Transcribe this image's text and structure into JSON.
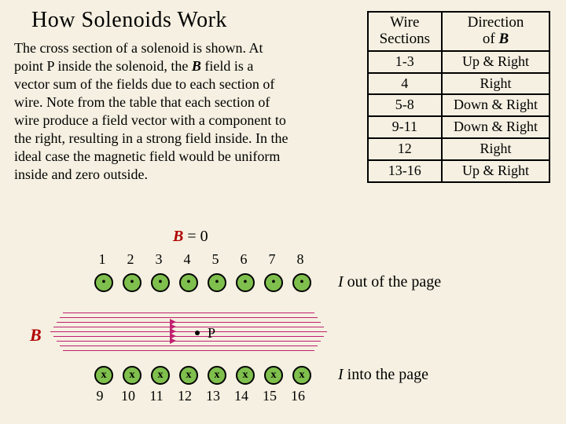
{
  "title": "How Solenoids Work",
  "body_before_B": "The cross section of a solenoid is shown. At point P inside the solenoid, the ",
  "body_B": "B",
  "body_after_B": " field is a vector sum of the fields due to each section of wire. Note from the table that each section of wire produce a field vector with a component to the right, resulting in a strong field inside.  In the ideal case the magnetic field would be uniform inside and zero outside.",
  "table": {
    "head1_a": "Wire",
    "head1_b": "Sections",
    "head2_a": "Direction",
    "head2_b": "of",
    "head2_c": "B",
    "rows": [
      {
        "ws": "1-3",
        "dir": "Up & Right"
      },
      {
        "ws": "4",
        "dir": "Right"
      },
      {
        "ws": "5-8",
        "dir": "Down & Right"
      },
      {
        "ws": "9-11",
        "dir": "Down & Right"
      },
      {
        "ws": "12",
        "dir": "Right"
      },
      {
        "ws": "13-16",
        "dir": "Up & Right"
      }
    ]
  },
  "diagram": {
    "bzero_B": "B",
    "bzero_eq": " = 0",
    "top_nums": [
      "1",
      "2",
      "3",
      "4",
      "5",
      "6",
      "7",
      "8"
    ],
    "bot_nums": [
      "9",
      "10",
      "11",
      "12",
      "13",
      "14",
      "15",
      "16"
    ],
    "B_label": "B",
    "P_label": "P",
    "I_out": "I",
    "I_out_rest": "  out of the page",
    "I_in": "I",
    "I_in_rest": "  into the page",
    "dot": "•",
    "cross": "x"
  },
  "chart_data": {
    "type": "table",
    "title": "Direction of B by wire section",
    "columns": [
      "Wire Sections",
      "Direction of B"
    ],
    "rows": [
      [
        "1-3",
        "Up & Right"
      ],
      [
        "4",
        "Right"
      ],
      [
        "5-8",
        "Down & Right"
      ],
      [
        "9-11",
        "Down & Right"
      ],
      [
        "12",
        "Right"
      ],
      [
        "13-16",
        "Up & Right"
      ]
    ]
  }
}
